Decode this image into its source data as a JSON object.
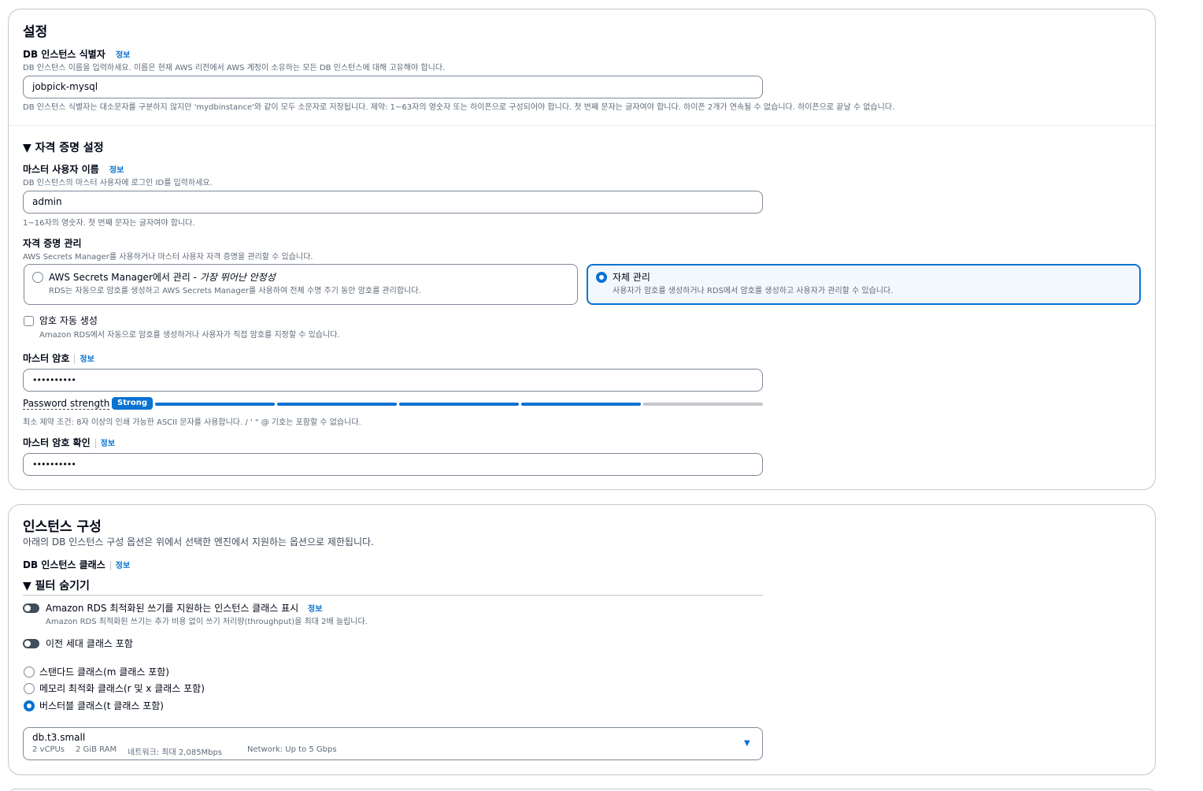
{
  "settings": {
    "title": "설정",
    "db_identifier": {
      "label": "DB 인스턴스 식별자",
      "info": "정보",
      "description": "DB 인스턴스 이름을 입력하세요. 이름은 현재 AWS 리전에서 AWS 계정이 소유하는 모든 DB 인스턴스에 대해 고유해야 합니다.",
      "value": "jobpick-mysql",
      "constraint": "DB 인스턴스 식별자는 대소문자를 구분하지 않지만 'mydbinstance'와 같이 모두 소문자로 저장됩니다. 제약: 1~63자의 영숫자 또는 하이픈으로 구성되어야 합니다. 첫 번째 문자는 글자여야 합니다. 하이픈 2개가 연속될 수 없습니다. 하이픈으로 끝날 수 없습니다."
    },
    "credentials": {
      "section_title": "▼ 자격 증명 설정",
      "master_username": {
        "label": "마스터 사용자 이름",
        "info": "정보",
        "description": "DB 인스턴스의 마스터 사용자에 로그인 ID를 입력하세요.",
        "value": "admin",
        "constraint": "1~16자의 영숫자. 첫 번째 문자는 글자여야 합니다."
      },
      "management": {
        "label": "자격 증명 관리",
        "description": "AWS Secrets Manager를 사용하거나 마스터 사용자 자격 증명을 관리할 수 있습니다.",
        "options": [
          {
            "title": "AWS Secrets Manager에서 관리 - ",
            "title_emphasis": "가장 뛰어난 안정성",
            "description": "RDS는 자동으로 암호를 생성하고 AWS Secrets Manager를 사용하여 전체 수명 주기 동안 암호를 관리합니다.",
            "selected": false
          },
          {
            "title": "자체 관리",
            "description": "사용자가 암호를 생성하거나 RDS에서 암호를 생성하고 사용자가 관리할 수 있습니다.",
            "selected": true
          }
        ]
      },
      "auto_generate": {
        "label": "암호 자동 생성",
        "description": "Amazon RDS에서 자동으로 암호를 생성하거나 사용자가 직접 암호를 지정할 수 있습니다.",
        "checked": false
      },
      "master_password": {
        "label": "마스터 암호",
        "info": "정보",
        "value": "••••••••••",
        "strength_label": "Password strength",
        "strength_badge": "Strong",
        "strength_level": 0.8,
        "constraint": "최소 제약 조건: 8자 이상의 인쇄 가능한 ASCII 문자를 사용합니다. / ' \" @ 기호는 포함할 수 없습니다."
      },
      "confirm_password": {
        "label": "마스터 암호 확인",
        "info": "정보",
        "value": "••••••••••"
      }
    }
  },
  "instance": {
    "title": "인스턴스 구성",
    "description": "아래의 DB 인스턴스 구성 옵션은 위에서 선택한 엔진에서 지원하는 옵션으로 제한됩니다.",
    "class_label": "DB 인스턴스 클래스",
    "info": "정보",
    "filter_title": "▼ 필터 숨기기",
    "toggle_optimized": {
      "label": "Amazon RDS 최적화된 쓰기를 지원하는 인스턴스 클래스 표시",
      "info": "정보",
      "description": "Amazon RDS 최적화된 쓰기는 추가 비용 없이 쓰기 처리량(throughput)을 최대 2배 늘립니다.",
      "on": false
    },
    "toggle_previous": {
      "label": "이전 세대 클래스 포함",
      "on": false
    },
    "class_options": [
      {
        "label": "스탠다드 클래스(m 클래스 포함)",
        "selected": false
      },
      {
        "label": "메모리 최적화 클래스(r 및 x 클래스 포함)",
        "selected": false
      },
      {
        "label": "버스터블 클래스(t 클래스 포함)",
        "selected": true
      }
    ],
    "selected_class": {
      "name": "db.t3.small",
      "vcpu": "2 vCPUs",
      "ram": "2 GiB RAM",
      "network_kr": "네트워크: 최대 2,085Mbps",
      "network": "Network: Up to 5 Gbps"
    }
  },
  "colors": {
    "accent": "#0972d3",
    "border": "#7d8998",
    "text": "#000716",
    "muted": "#5f6b7a"
  }
}
